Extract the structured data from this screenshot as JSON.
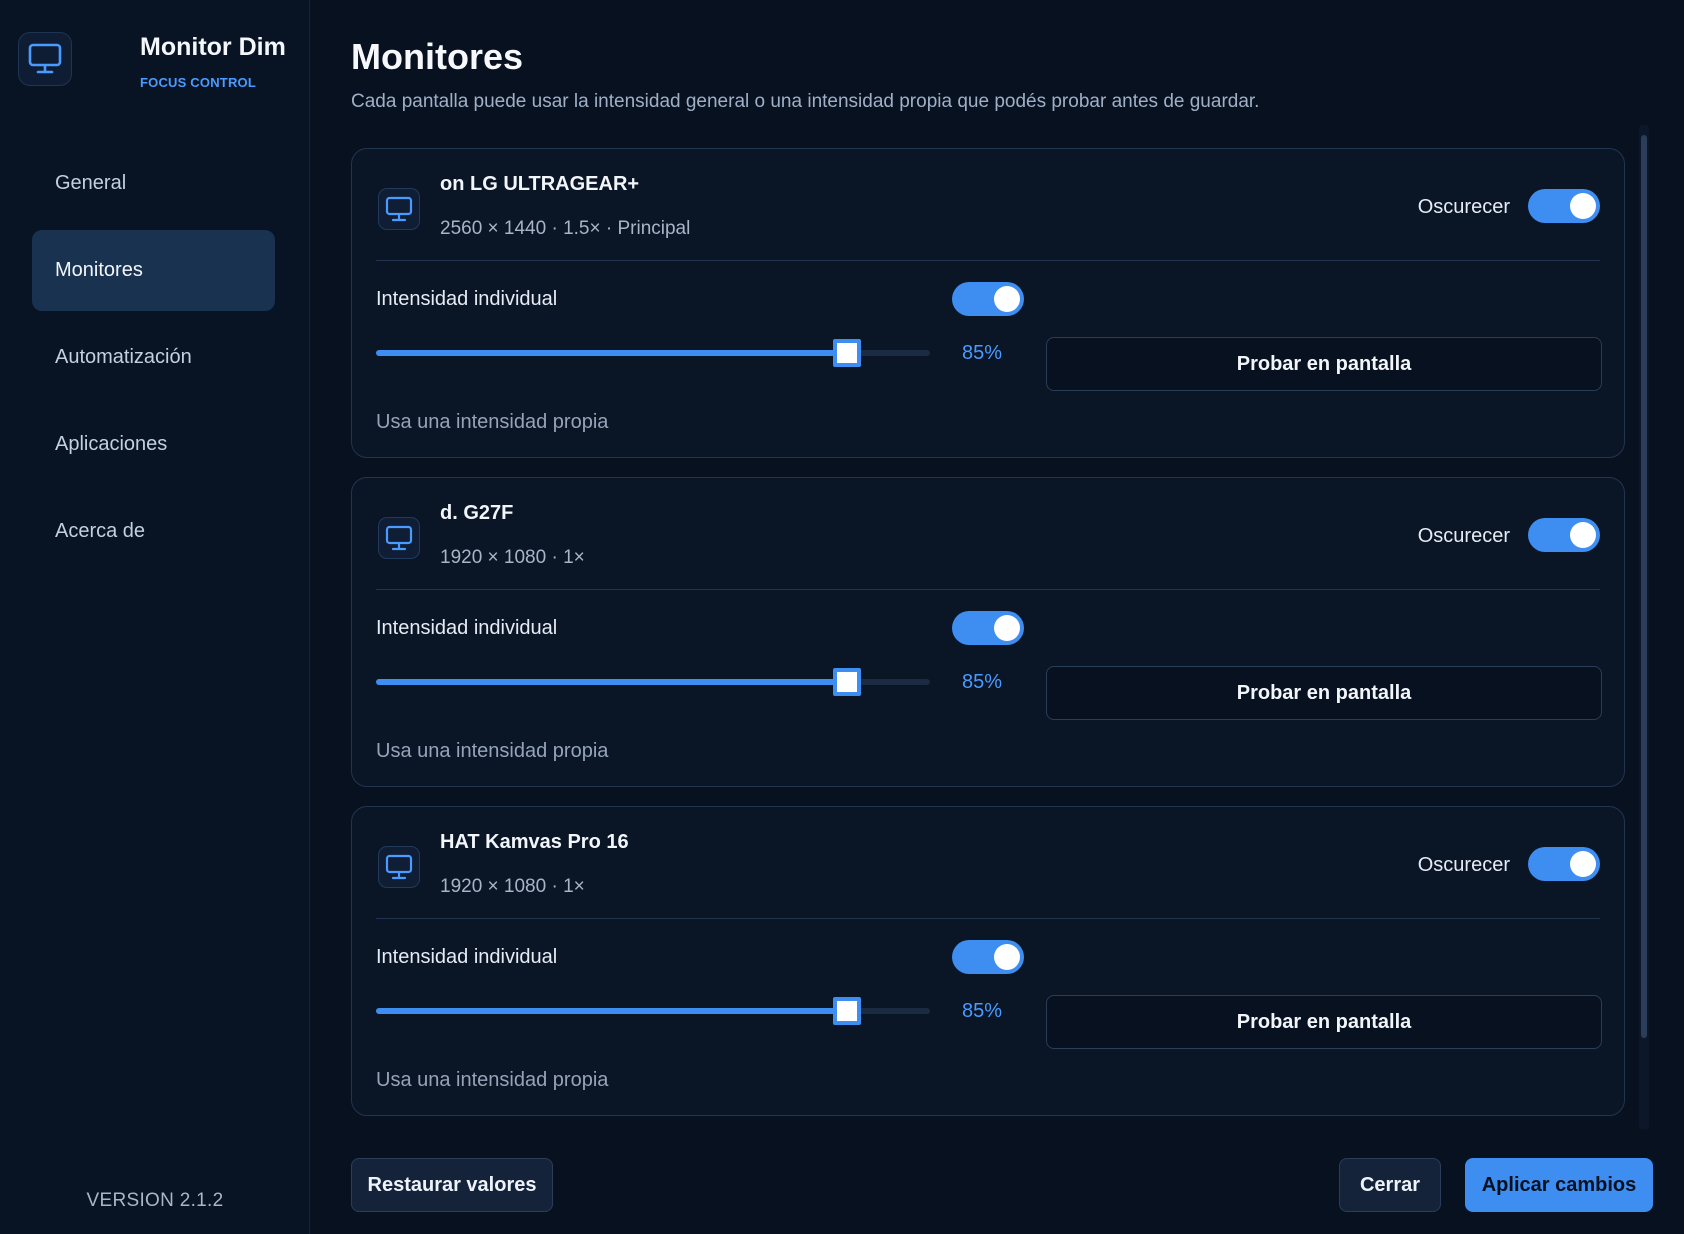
{
  "app": {
    "title": "Monitor Dim",
    "subtitle": "FOCUS CONTROL",
    "version": "VERSION 2.1.2"
  },
  "sidebar": {
    "items": [
      {
        "label": "General",
        "active": false
      },
      {
        "label": "Monitores",
        "active": true
      },
      {
        "label": "Automatización",
        "active": false
      },
      {
        "label": "Aplicaciones",
        "active": false
      },
      {
        "label": "Acerca de",
        "active": false
      }
    ]
  },
  "page": {
    "title": "Monitores",
    "subtitle": "Cada pantalla puede usar la intensidad general o una intensidad propia que podés probar antes de guardar."
  },
  "monitors": [
    {
      "name": "on LG ULTRAGEAR+",
      "meta": "2560 × 1440  ·  1.5×  ·  Principal",
      "dim_label": "Oscurecer",
      "dim_on": true,
      "individual_label": "Intensidad individual",
      "individual_on": true,
      "intensity": 85,
      "intensity_text": "85%",
      "test_label": "Probar en pantalla",
      "hint": "Usa una intensidad propia"
    },
    {
      "name": "d. G27F",
      "meta": "1920 × 1080  ·  1×",
      "dim_label": "Oscurecer",
      "dim_on": true,
      "individual_label": "Intensidad individual",
      "individual_on": true,
      "intensity": 85,
      "intensity_text": "85%",
      "test_label": "Probar en pantalla",
      "hint": "Usa una intensidad propia"
    },
    {
      "name": "HAT Kamvas Pro 16",
      "meta": "1920 × 1080  ·  1×",
      "dim_label": "Oscurecer",
      "dim_on": true,
      "individual_label": "Intensidad individual",
      "individual_on": true,
      "intensity": 85,
      "intensity_text": "85%",
      "test_label": "Probar en pantalla",
      "hint": "Usa una intensidad propia"
    }
  ],
  "footer": {
    "restore_label": "Restaurar valores",
    "close_label": "Cerrar",
    "apply_label": "Aplicar cambios"
  },
  "colors": {
    "accent": "#3d8ef0",
    "background": "#081120",
    "card_border": "#223550"
  }
}
